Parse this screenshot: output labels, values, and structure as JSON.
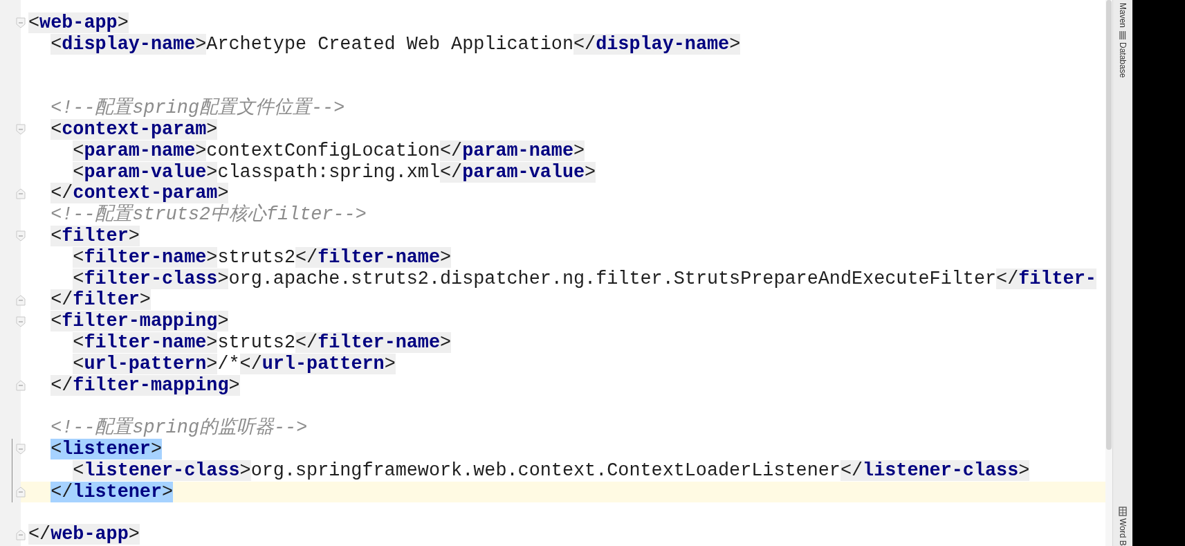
{
  "editor": {
    "lines": [
      {
        "kind": "code",
        "fold": {
          "kind": "start"
        },
        "caret": false,
        "changed": false,
        "tokens": [
          {
            "kind": "tag",
            "open": "<",
            "name": "web-app",
            "close": ">",
            "matched": false
          }
        ],
        "children": [
          {
            "kind": "code",
            "caret": false,
            "changed": false,
            "tokens": [
              {
                "kind": "tag",
                "open": "<",
                "name": "display-name",
                "close": ">",
                "matched": false
              },
              {
                "kind": "text",
                "text": "Archetype Created Web Application"
              },
              {
                "kind": "tag",
                "open": "</",
                "name": "display-name",
                "close": ">",
                "matched": false
              }
            ]
          },
          {
            "kind": "blank",
            "caret": false,
            "changed": false
          },
          {
            "kind": "blank",
            "caret": false,
            "changed": false
          },
          {
            "kind": "code",
            "caret": false,
            "changed": false,
            "tokens": [
              {
                "kind": "comment",
                "text": "<!--配置spring配置文件位置-->"
              }
            ]
          },
          {
            "kind": "code",
            "fold": {
              "kind": "start"
            },
            "caret": false,
            "changed": false,
            "tokens": [
              {
                "kind": "tag",
                "open": "<",
                "name": "context-param",
                "close": ">",
                "matched": false
              }
            ],
            "children": [
              {
                "kind": "code",
                "caret": false,
                "changed": false,
                "tokens": [
                  {
                    "kind": "tag",
                    "open": "<",
                    "name": "param-name",
                    "close": ">",
                    "matched": false
                  },
                  {
                    "kind": "text",
                    "text": "contextConfigLocation"
                  },
                  {
                    "kind": "tag",
                    "open": "</",
                    "name": "param-name",
                    "close": ">",
                    "matched": false
                  }
                ]
              },
              {
                "kind": "code",
                "caret": false,
                "changed": false,
                "tokens": [
                  {
                    "kind": "tag",
                    "open": "<",
                    "name": "param-value",
                    "close": ">",
                    "matched": false
                  },
                  {
                    "kind": "text",
                    "text": "classpath:spring.xml"
                  },
                  {
                    "kind": "tag",
                    "open": "</",
                    "name": "param-value",
                    "close": ">",
                    "matched": false
                  }
                ]
              }
            ]
          },
          {
            "kind": "code",
            "fold": {
              "kind": "end"
            },
            "caret": false,
            "changed": false,
            "tokens": [
              {
                "kind": "tag",
                "open": "</",
                "name": "context-param",
                "close": ">",
                "matched": false
              }
            ]
          },
          {
            "kind": "code",
            "caret": false,
            "changed": false,
            "tokens": [
              {
                "kind": "comment",
                "text": "<!--配置struts2中核心filter-->"
              }
            ]
          },
          {
            "kind": "code",
            "fold": {
              "kind": "start"
            },
            "caret": false,
            "changed": false,
            "tokens": [
              {
                "kind": "tag",
                "open": "<",
                "name": "filter",
                "close": ">",
                "matched": false
              }
            ],
            "children": [
              {
                "kind": "code",
                "caret": false,
                "changed": false,
                "tokens": [
                  {
                    "kind": "tag",
                    "open": "<",
                    "name": "filter-name",
                    "close": ">",
                    "matched": false
                  },
                  {
                    "kind": "text",
                    "text": "struts2"
                  },
                  {
                    "kind": "tag",
                    "open": "</",
                    "name": "filter-name",
                    "close": ">",
                    "matched": false
                  }
                ]
              },
              {
                "kind": "code",
                "caret": false,
                "changed": false,
                "tokens": [
                  {
                    "kind": "tag",
                    "open": "<",
                    "name": "filter-class",
                    "close": ">",
                    "matched": false
                  },
                  {
                    "kind": "text",
                    "text": "org.apache.struts2.dispatcher.ng.filter.StrutsPrepareAndExecuteFilter"
                  },
                  {
                    "kind": "tag",
                    "open": "</",
                    "name": "filter-",
                    "matched": false
                  }
                ]
              }
            ]
          },
          {
            "kind": "code",
            "fold": {
              "kind": "end"
            },
            "caret": false,
            "changed": false,
            "tokens": [
              {
                "kind": "tag",
                "open": "</",
                "name": "filter",
                "close": ">",
                "matched": false
              }
            ]
          },
          {
            "kind": "code",
            "fold": {
              "kind": "start"
            },
            "caret": false,
            "changed": false,
            "tokens": [
              {
                "kind": "tag",
                "open": "<",
                "name": "filter-mapping",
                "close": ">",
                "matched": false
              }
            ],
            "children": [
              {
                "kind": "code",
                "caret": false,
                "changed": false,
                "tokens": [
                  {
                    "kind": "tag",
                    "open": "<",
                    "name": "filter-name",
                    "close": ">",
                    "matched": false
                  },
                  {
                    "kind": "text",
                    "text": "struts2"
                  },
                  {
                    "kind": "tag",
                    "open": "</",
                    "name": "filter-name",
                    "close": ">",
                    "matched": false
                  }
                ]
              },
              {
                "kind": "code",
                "caret": false,
                "changed": false,
                "tokens": [
                  {
                    "kind": "tag",
                    "open": "<",
                    "name": "url-pattern",
                    "close": ">",
                    "matched": false
                  },
                  {
                    "kind": "text",
                    "text": "/*"
                  },
                  {
                    "kind": "tag",
                    "open": "</",
                    "name": "url-pattern",
                    "close": ">",
                    "matched": false
                  }
                ]
              }
            ]
          },
          {
            "kind": "code",
            "fold": {
              "kind": "end"
            },
            "caret": false,
            "changed": false,
            "tokens": [
              {
                "kind": "tag",
                "open": "</",
                "name": "filter-mapping",
                "close": ">",
                "matched": false
              }
            ]
          },
          {
            "kind": "blank",
            "caret": false,
            "changed": false
          },
          {
            "kind": "code",
            "caret": false,
            "changed": false,
            "tokens": [
              {
                "kind": "comment",
                "text": "<!--配置spring的监听器-->"
              }
            ]
          },
          {
            "kind": "code",
            "fold": {
              "kind": "start"
            },
            "caret": false,
            "changed": true,
            "tokens": [
              {
                "kind": "tag",
                "open": "<",
                "name": "listener",
                "close": ">",
                "matched": true
              }
            ],
            "children": [
              {
                "kind": "code",
                "caret": false,
                "changed": true,
                "tokens": [
                  {
                    "kind": "tag",
                    "open": "<",
                    "name": "listener-class",
                    "close": ">",
                    "matched": false
                  },
                  {
                    "kind": "text",
                    "text": "org.springframework.web.context.ContextLoaderListener"
                  },
                  {
                    "kind": "tag",
                    "open": "</",
                    "name": "listener-class",
                    "close": ">",
                    "matched": false
                  }
                ]
              }
            ]
          },
          {
            "kind": "code",
            "fold": {
              "kind": "end"
            },
            "caret": true,
            "changed": true,
            "tokens": [
              {
                "kind": "tag",
                "open": "</",
                "name": "listener",
                "close": ">",
                "matched": true
              }
            ]
          },
          {
            "kind": "blank",
            "caret": false,
            "changed": false
          }
        ]
      },
      {
        "kind": "code",
        "fold": {
          "kind": "end"
        },
        "caret": false,
        "changed": false,
        "tokens": [
          {
            "kind": "tag",
            "open": "</",
            "name": "web-app",
            "close": ">",
            "matched": false
          }
        ]
      }
    ]
  },
  "tool_strip": {
    "items": [
      {
        "kind": "text",
        "label": "Maven"
      },
      {
        "kind": "database",
        "label": "Database"
      },
      {
        "kind": "book",
        "label": "Word B"
      }
    ]
  }
}
